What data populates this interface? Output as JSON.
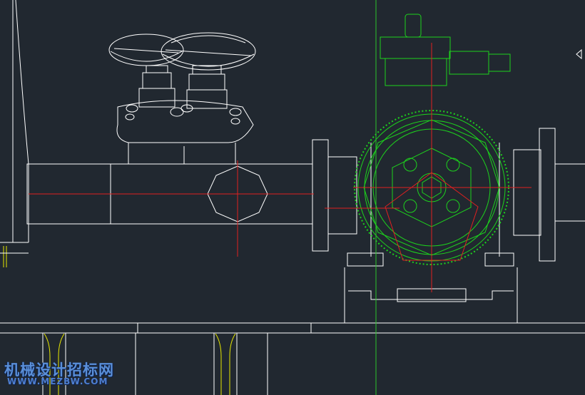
{
  "drawing": {
    "type": "2D mechanical CAD drawing",
    "subject": "valve, piping and explosion-proof electric motor (end view)",
    "colors": {
      "background": "#212830",
      "outline": "#ffffff",
      "motor": "#1dd21d",
      "centerline": "#e02020",
      "vertical_axis": "#2ac42a",
      "hatch": "#e8e800"
    }
  },
  "watermark": {
    "title": "机械设计招标网",
    "url": "WWW.MEZBW.COM"
  }
}
